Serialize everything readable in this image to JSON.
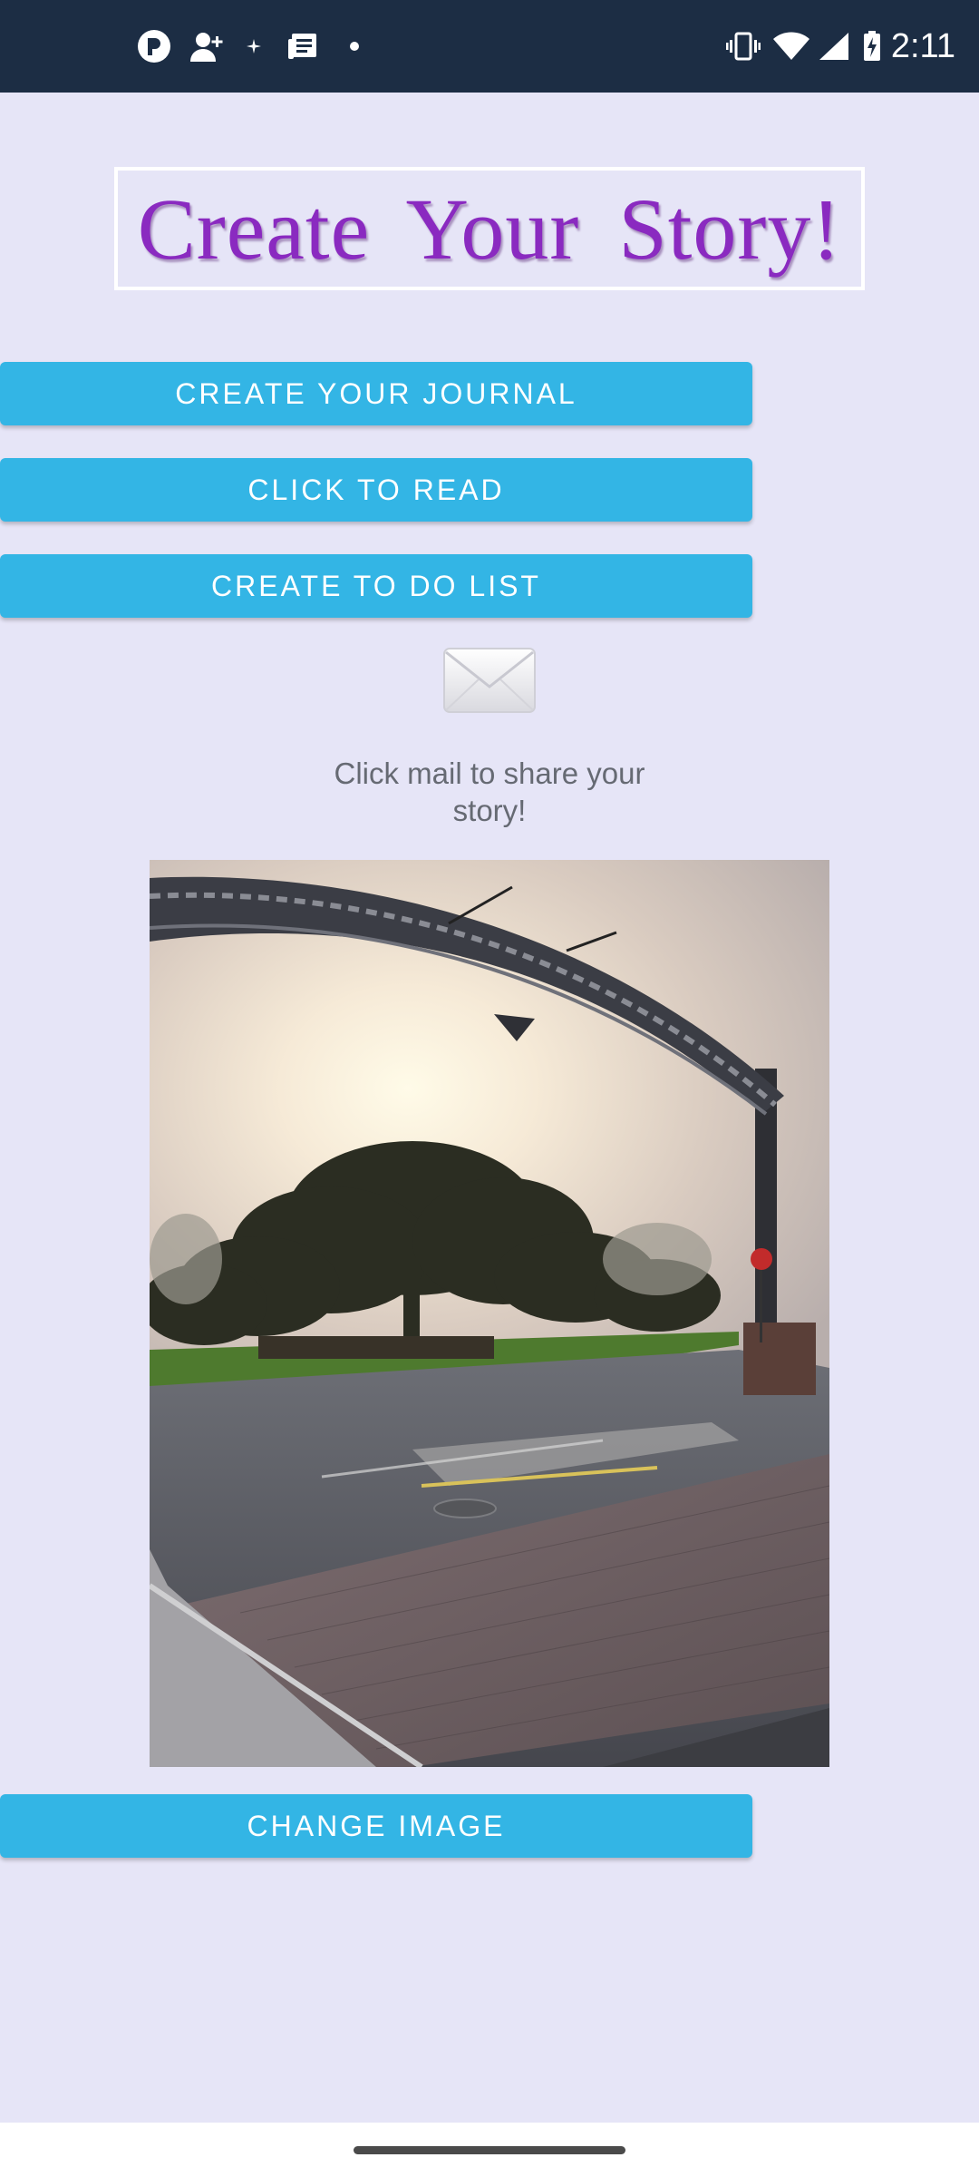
{
  "status_bar": {
    "time": "2:11",
    "left_icons": [
      "app-icon",
      "add-user-icon",
      "sparkle-icon",
      "news-icon",
      "dot-icon"
    ],
    "right_icons": [
      "vibrate-icon",
      "wifi-icon",
      "signal-icon",
      "battery-charging-icon"
    ]
  },
  "header": {
    "title": "Create Your Story!",
    "title_color": "#8a2ac0"
  },
  "buttons": {
    "create_journal": "CREATE YOUR JOURNAL",
    "click_to_read": "CLICK TO READ",
    "create_todo": "CREATE TO DO LIST",
    "change_image": "CHANGE IMAGE"
  },
  "share": {
    "icon": "mail-icon",
    "text": "Click mail to share your story!"
  },
  "photo": {
    "description_icon": "photo-arch-sunset"
  },
  "colors": {
    "background": "#e6e5f7",
    "status_bar": "#1c2d44",
    "button": "#33b5e5",
    "button_text": "#ffffff"
  }
}
